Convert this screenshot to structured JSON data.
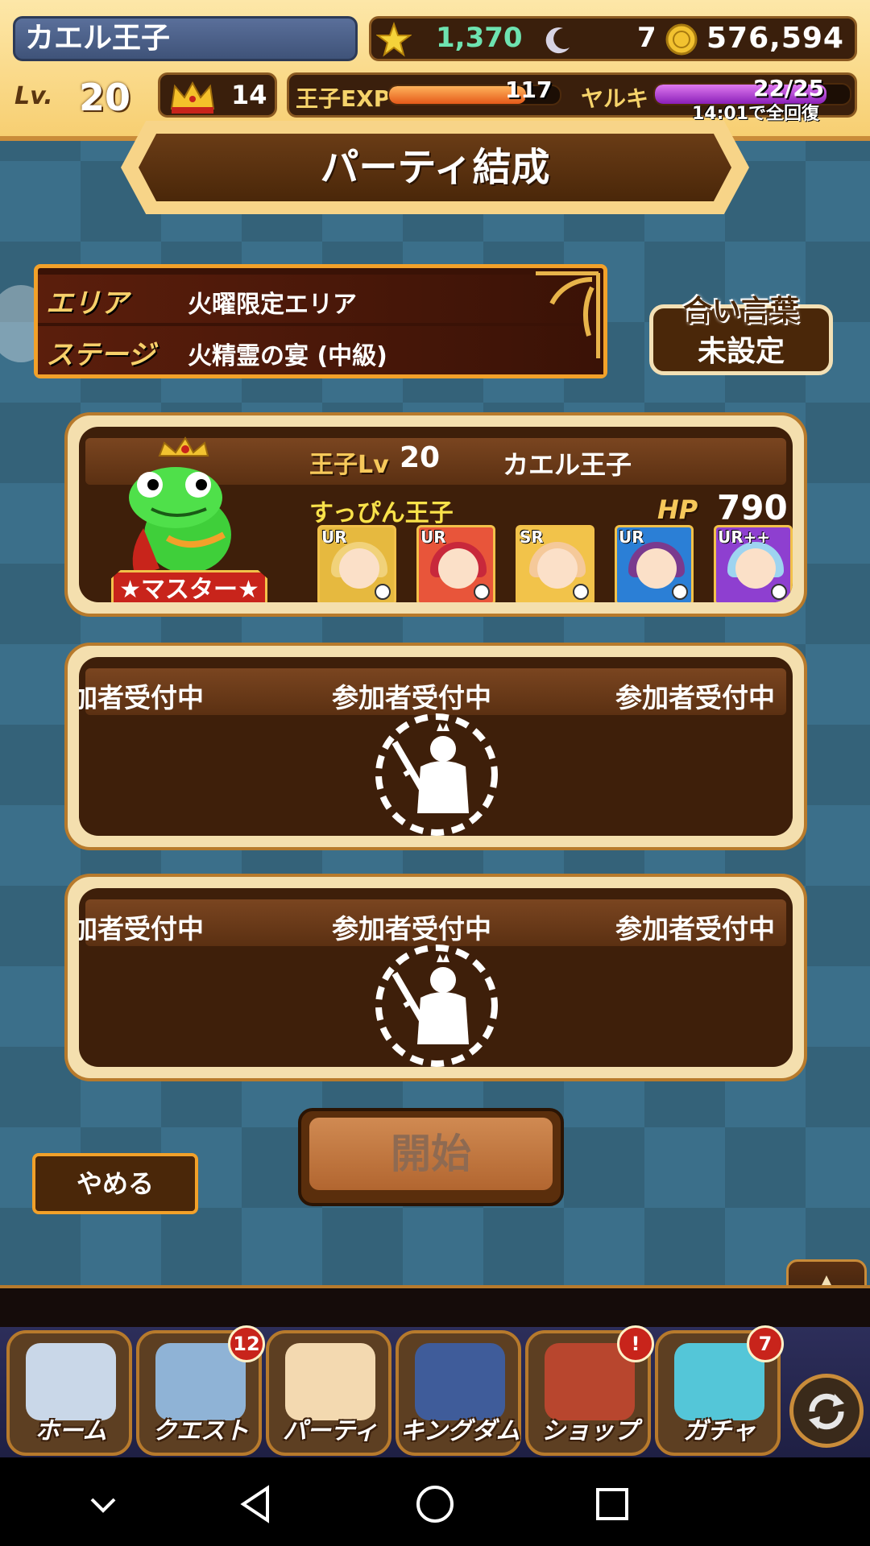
{
  "player": {
    "name": "カエル王子",
    "level_label": "Lv.",
    "level": "20",
    "stamina": "1,370",
    "moons": "7",
    "coins": "576,594",
    "crowns": "14",
    "exp_label": "王子EXP",
    "exp_value": "117",
    "exp_fraction": 0.8,
    "yaruki_label": "ヤルキ",
    "yaruki_value": "22/25",
    "yaruki_fraction": 0.88,
    "recover_text": "14:01で全回復"
  },
  "title": "パーティ結成",
  "area": {
    "area_label": "エリア",
    "area_value": "火曜限定エリア",
    "stage_label": "ステージ",
    "stage_value": "火精霊の宴 (中級)"
  },
  "aikotoba": {
    "title": "合い言葉",
    "value": "未設定"
  },
  "master": {
    "prince_lv_label": "王子Lv",
    "prince_lv": "20",
    "prince_name": "カエル王子",
    "prince_title": "すっぴん王子",
    "hp_label": "HP",
    "hp_value": "790",
    "badge": "★マスター★",
    "cards": [
      {
        "rarity": "UR",
        "hair": "#f1d27a",
        "bg": "#e6b93f"
      },
      {
        "rarity": "UR",
        "hair": "#c8283b",
        "bg": "#e8553a"
      },
      {
        "rarity": "SR",
        "hair": "#f5c99a",
        "bg": "#f2c34a"
      },
      {
        "rarity": "UR",
        "hair": "#7a3a8e",
        "bg": "#2b7fd6"
      },
      {
        "rarity": "UR++",
        "hair": "#9ed4f0",
        "bg": "#8e3fd0"
      }
    ]
  },
  "recruit": {
    "label_left": "加者受付中",
    "label_mid": "参加者受付中",
    "label_right": "参加者受付中"
  },
  "buttons": {
    "start": "開始",
    "cancel": "やめる",
    "scroll_up": "▲"
  },
  "menu": {
    "items": [
      {
        "label": "ホーム",
        "badge": "",
        "art": "#c9d7e8"
      },
      {
        "label": "クエスト",
        "badge": "12",
        "art": "#8fb3d6"
      },
      {
        "label": "パーティ",
        "badge": "",
        "art": "#f3d9b0"
      },
      {
        "label": "キングダム",
        "badge": "",
        "art": "#3f5c9a"
      },
      {
        "label": "ショップ",
        "badge": "!",
        "art": "#b8462e"
      },
      {
        "label": "ガチャ",
        "badge": "7",
        "art": "#54c6d8"
      }
    ]
  }
}
